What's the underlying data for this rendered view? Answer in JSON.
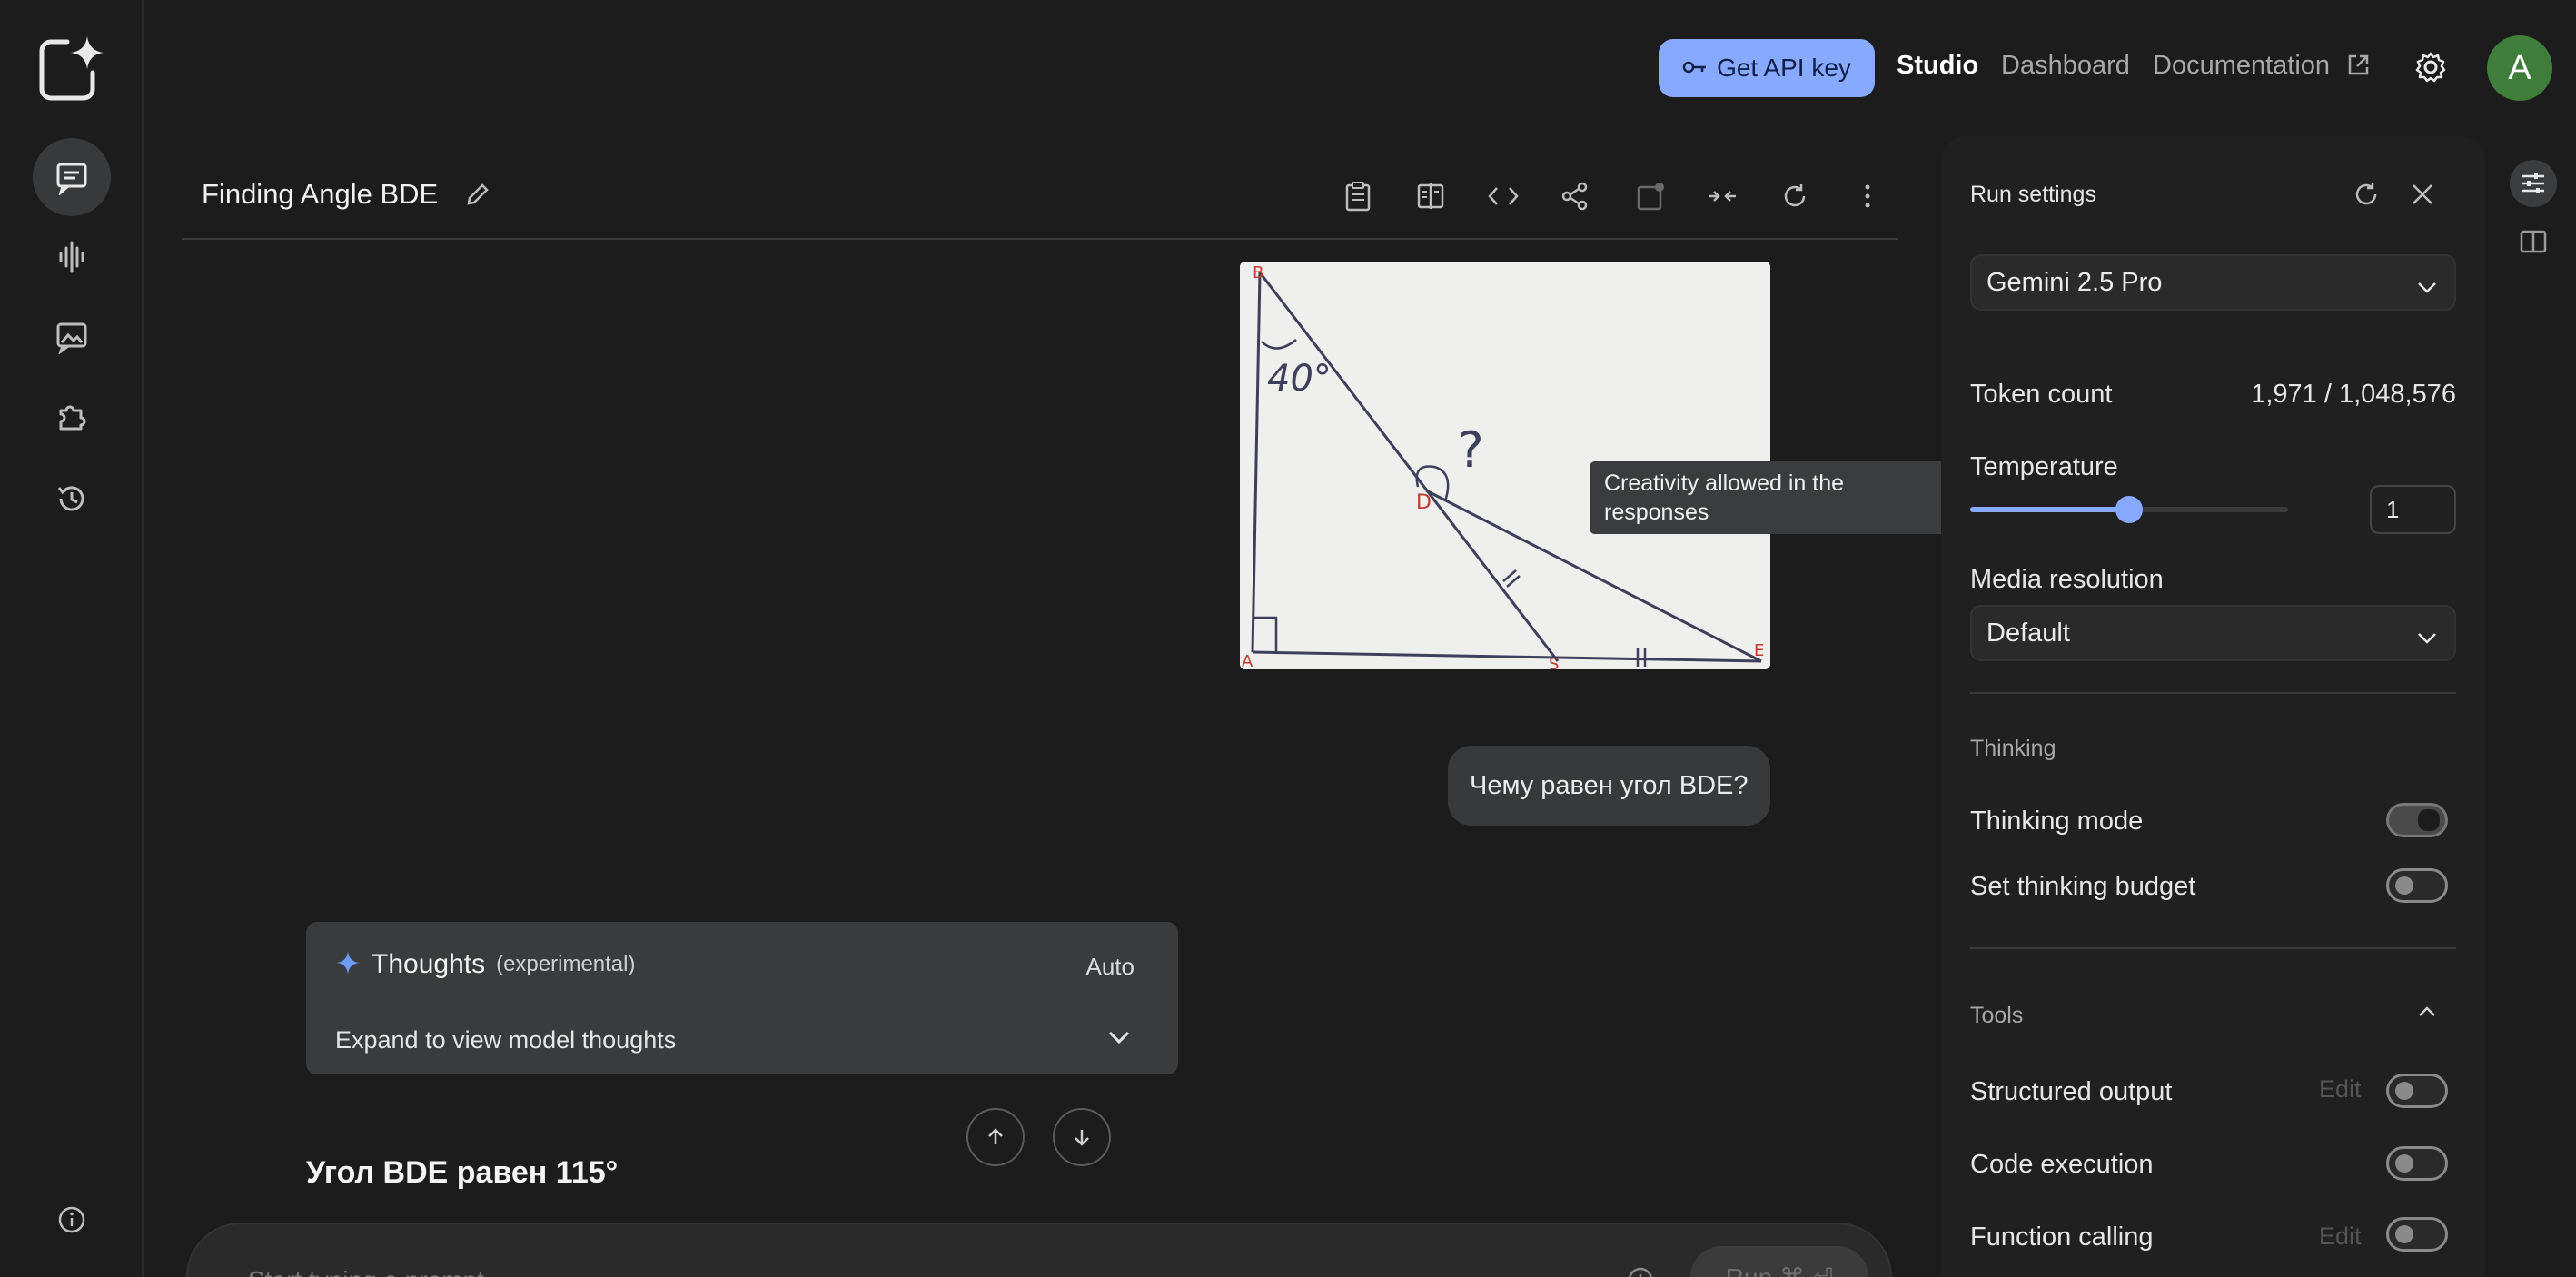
{
  "topbar": {
    "api_button": "Get API key",
    "links": [
      "Studio",
      "Dashboard",
      "Documentation"
    ],
    "avatar_letter": "A"
  },
  "chat": {
    "title": "Finding Angle BDE",
    "user_message": "Чему равен угол BDE?",
    "tooltip": "Creativity allowed in the responses",
    "thoughts": {
      "title": "Thoughts",
      "tag": "(experimental)",
      "mode": "Auto",
      "expand_label": "Expand to view model thoughts"
    },
    "answer": "Угол BDE равен 115°",
    "prompt_placeholder": "Start typing a prompt",
    "run_label": "Run ⌘ ⏎",
    "image_labels": {
      "b": "B",
      "a": "A",
      "d": "D",
      "e": "E",
      "s": "S",
      "angle": "40°",
      "q": "?"
    }
  },
  "settings": {
    "title": "Run settings",
    "model": "Gemini 2.5 Pro",
    "token_label": "Token count",
    "token_value": "1,971 / 1,048,576",
    "temperature_label": "Temperature",
    "temperature_value": "1",
    "temperature_fraction": 0.5,
    "media_label": "Media resolution",
    "media_value": "Default",
    "thinking_section": "Thinking",
    "thinking_mode": "Thinking mode",
    "thinking_budget": "Set thinking budget",
    "tools_section": "Tools",
    "structured_output": "Structured output",
    "code_execution": "Code execution",
    "function_calling": "Function calling",
    "edit_label": "Edit"
  },
  "colors": {
    "accent": "#87a9ff",
    "avatar": "#3f7d3a"
  }
}
